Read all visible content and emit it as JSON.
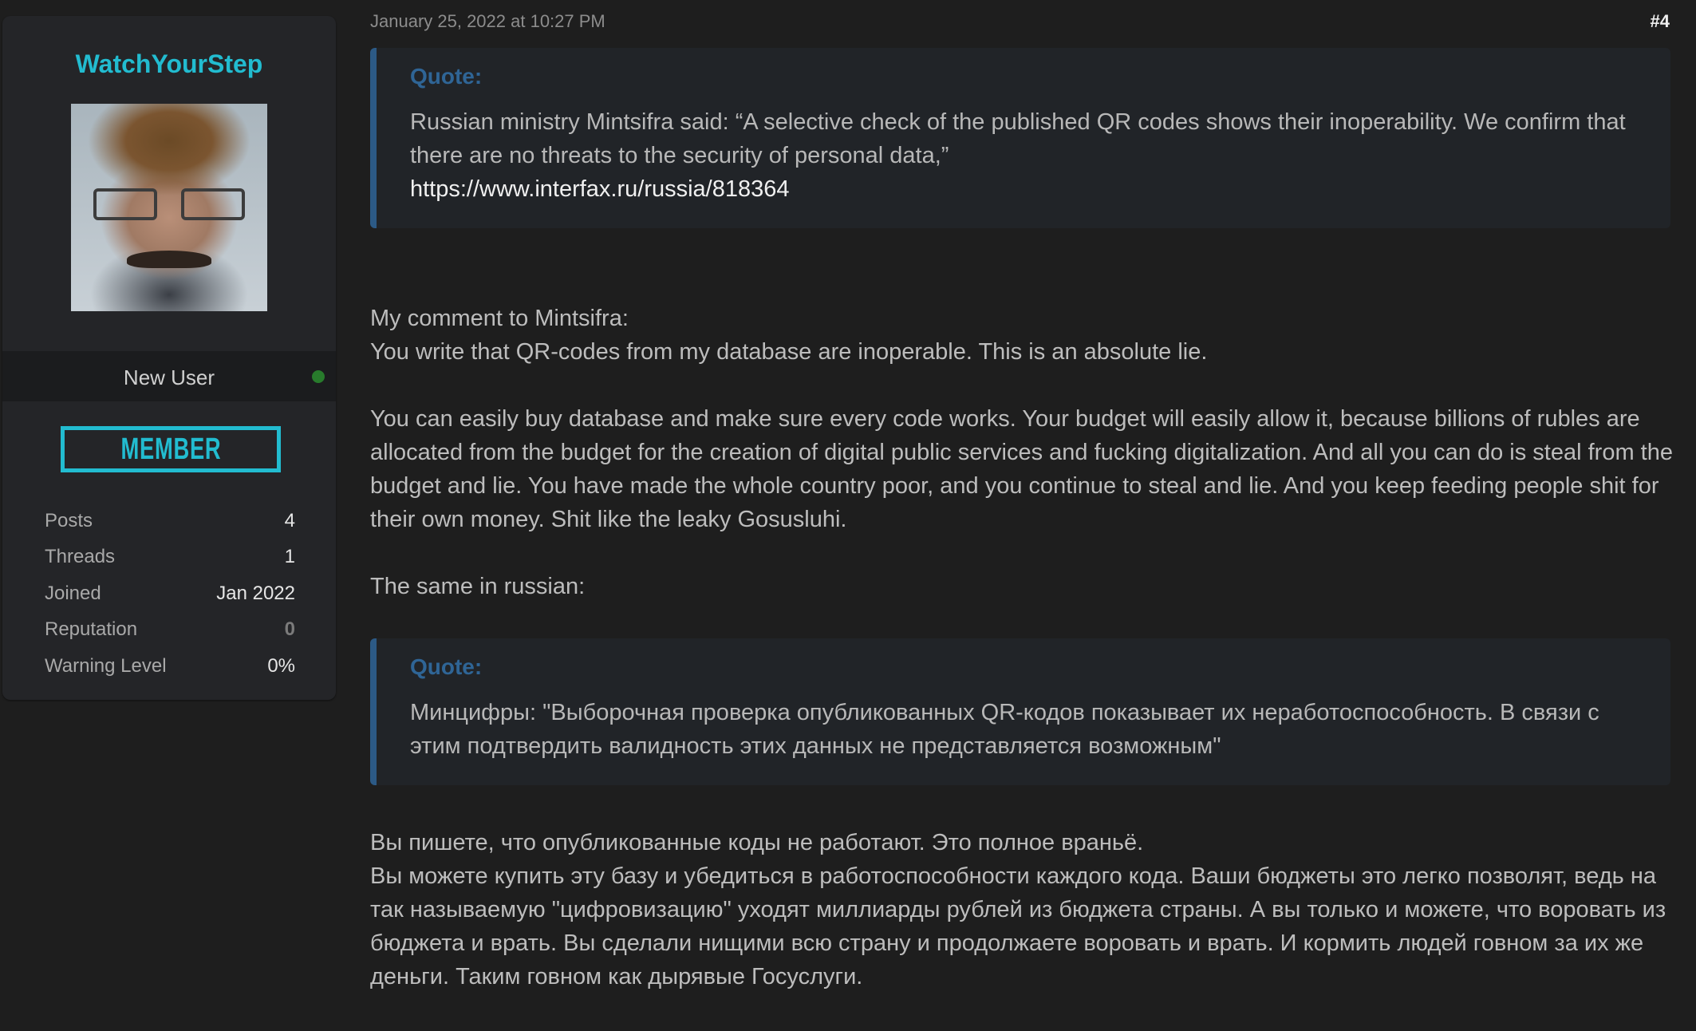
{
  "author": {
    "username": "WatchYourStep",
    "avatar_alt": "user-avatar",
    "rank_title": "New User",
    "online_status": "online",
    "badge": "MEMBER",
    "stats": [
      {
        "label": "Posts",
        "value": "4"
      },
      {
        "label": "Threads",
        "value": "1"
      },
      {
        "label": "Joined",
        "value": "Jan 2022"
      },
      {
        "label": "Reputation",
        "value": "0"
      },
      {
        "label": "Warning Level",
        "value": "0%"
      }
    ]
  },
  "post": {
    "date": "January 25, 2022 at 10:27 PM",
    "number": "#4",
    "quote1": {
      "label": "Quote:",
      "text": "Russian ministry Mintsifra said: “A selective check of the published QR codes shows their inoperability. We confirm that there are no threats to the security of personal data,”",
      "link": "https://www.interfax.ru/russia/818364"
    },
    "comment_heading": "My comment to Mintsifra:",
    "comment_line1": "You write that QR-codes from my database are inoperable. This is an absolute lie.",
    "comment_paragraph": "You can easily buy database and make sure every code works. Your budget will easily allow it, because billions of rubles are allocated from the budget for the creation of digital public services and fucking digitalization. And all you can do is steal from the budget and lie. You have made the whole country poor, and you continue to steal and lie. And you keep feeding people shit for their own money. Shit like the leaky Gosusluhi.",
    "russian_intro": "The same in russian:",
    "quote2": {
      "label": "Quote:",
      "text": "Минцифры: \"Выборочная проверка опубликованных QR-кодов показывает их неработоспособность. В связи с этим подтвердить валидность этих данных не представляется возможным\""
    },
    "russian_line1": "Вы пишете, что опубликованные коды не работают. Это полное враньё.",
    "russian_paragraph": "Вы можете купить эту базу и убедиться в работоспособности каждого кода. Ваши бюджеты это легко позволят, ведь на так называемую \"цифровизацию\" уходят миллиарды рублей из бюджета страны. А вы только и можете, что воровать из бюджета и врать. Вы сделали нищими всю страну и продолжаете воровать и врать. И кормить людей говном за их же деньги. Таким говном как дырявые Госуслуги."
  },
  "colors": {
    "accent_cyan": "#22bcd0",
    "quote_border": "#2c5a86",
    "online_green": "#287b2c"
  }
}
